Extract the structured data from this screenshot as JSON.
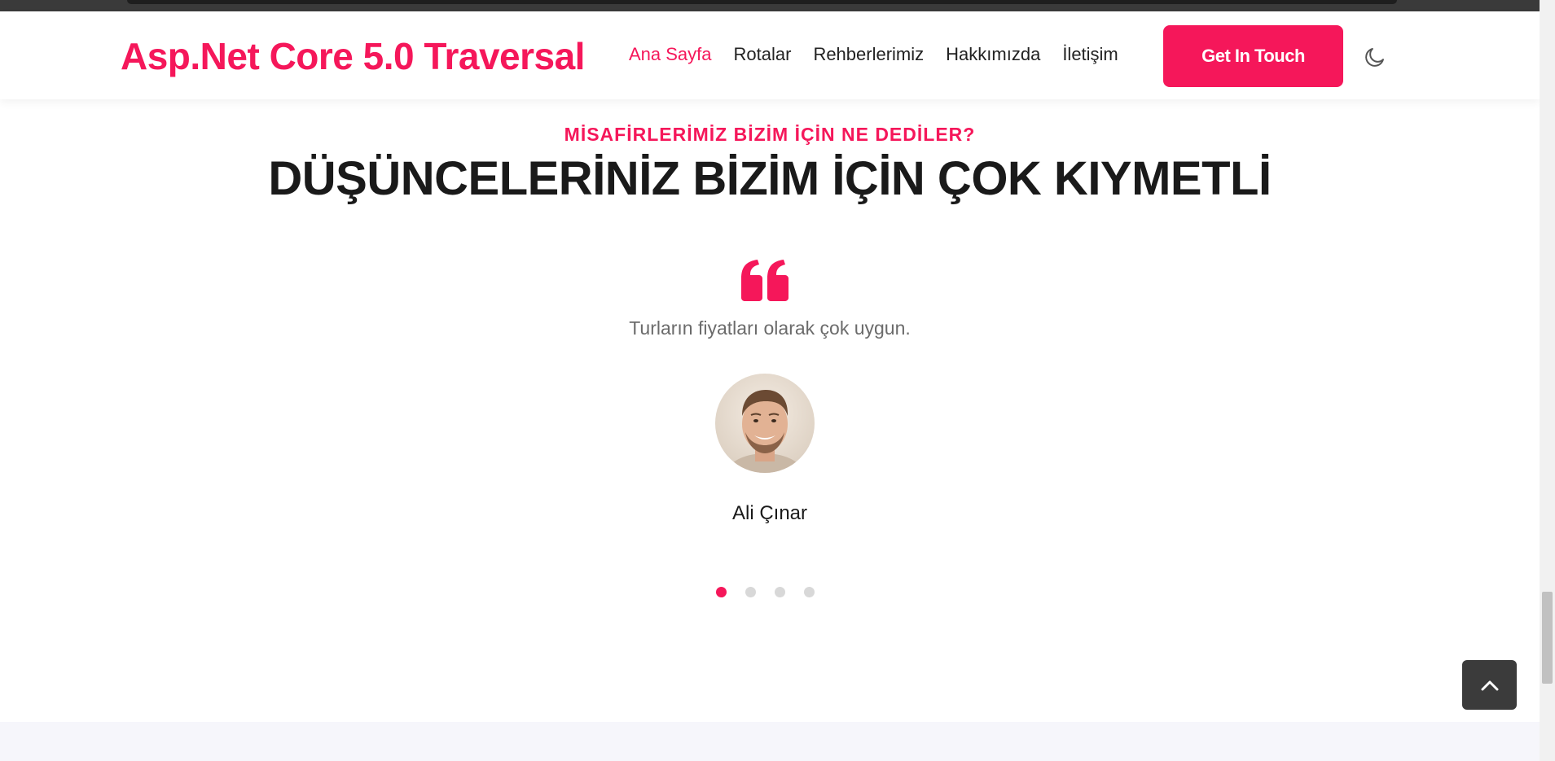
{
  "header": {
    "brand": "Asp.Net Core 5.0 Traversal",
    "nav": [
      {
        "label": "Ana Sayfa",
        "active": true
      },
      {
        "label": "Rotalar",
        "active": false
      },
      {
        "label": "Rehberlerimiz",
        "active": false
      },
      {
        "label": "Hakkımızda",
        "active": false
      },
      {
        "label": "İletişim",
        "active": false
      }
    ],
    "cta_label": "Get In Touch",
    "theme_toggle_icon": "moon-icon"
  },
  "testimonials": {
    "eyebrow": "MİSAFİRLERİMİZ BİZİM İÇİN NE DEDİLER?",
    "title": "DÜŞÜNCELERİNİZ BİZİM İÇİN ÇOK KIYMETLİ",
    "quote_icon": "quote-icon",
    "quote": "Turların fiyatları olarak çok uygun.",
    "author": "Ali Çınar",
    "slides_count": 4,
    "active_slide": 1
  },
  "back_to_top_icon": "chevron-up-icon",
  "colors": {
    "accent": "#f5175a",
    "text_dark": "#1a1a1a",
    "text_muted": "#6b6b6b",
    "back_to_top_bg": "#3b3b3b"
  }
}
